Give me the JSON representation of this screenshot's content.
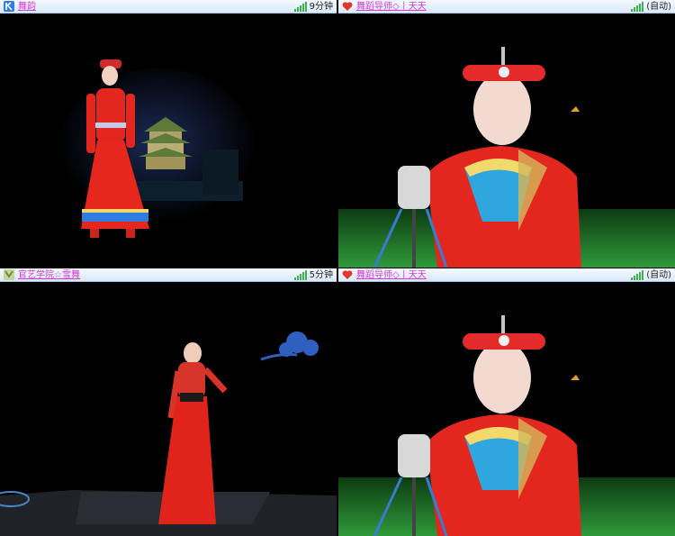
{
  "panels": [
    {
      "icon": "k-logo-icon",
      "name": "舞韵",
      "status": "9分钟",
      "icon_color": "#2f7de1"
    },
    {
      "icon": "heart-icon",
      "name": "舞蹈导师◇丨天天",
      "status": "(自动)",
      "icon_color": "#e0362c"
    },
    {
      "icon": "avatar-icon",
      "name": "官艺学院☆雪舞",
      "status": "5分钟",
      "icon_color": "#6a8a3c"
    },
    {
      "icon": "heart-icon",
      "name": "舞蹈导师◇丨天天",
      "status": "(自动)",
      "icon_color": "#e0362c"
    }
  ],
  "colors": {
    "name_link": "#d23bd2",
    "signal": "#39b54a",
    "titlebar": "#dbe9fb"
  }
}
